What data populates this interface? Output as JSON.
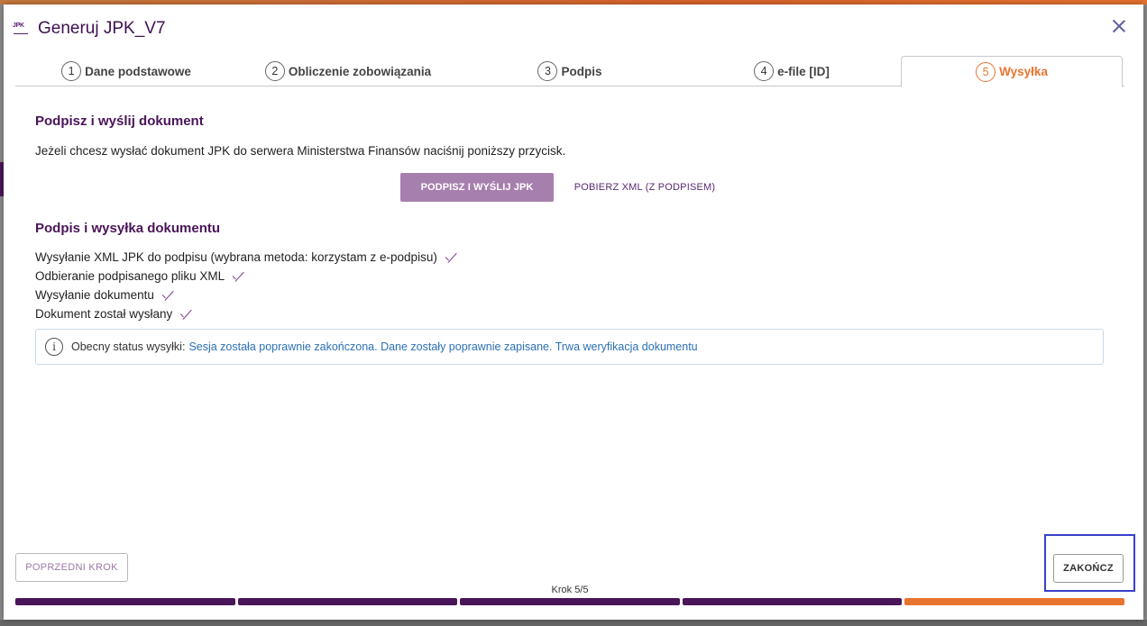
{
  "dialog": {
    "icon_label": "JPK",
    "title": "Generuj JPK_V7"
  },
  "tabs": [
    {
      "num": "1",
      "label": "Dane podstawowe",
      "active": false
    },
    {
      "num": "2",
      "label": "Obliczenie zobowiązania",
      "active": false
    },
    {
      "num": "3",
      "label": "Podpis",
      "active": false
    },
    {
      "num": "4",
      "label": "e-file [ID]",
      "active": false
    },
    {
      "num": "5",
      "label": "Wysyłka",
      "active": true
    }
  ],
  "sign_section": {
    "title": "Podpisz i wyślij dokument",
    "description": "Jeżeli chcesz wysłać dokument JPK do serwera Ministerstwa Finansów naciśnij poniższy przycisk.",
    "sign_send_button": "PODPISZ I WYŚLIJ JPK",
    "download_xml_button": "POBIERZ XML (Z PODPISEM)"
  },
  "progress_section": {
    "title": "Podpis i wysyłka dokumentu",
    "steps": [
      "Wysyłanie XML JPK do podpisu (wybrana metoda: korzystam z e-podpisu)",
      "Odbieranie podpisanego pliku XML",
      "Wysyłanie dokumentu",
      "Dokument został wysłany"
    ]
  },
  "status": {
    "icon": "info-icon",
    "label": "Obecny status wysyłki:",
    "value": "Sesja została poprawnie zakończona. Dane zostały poprawnie zapisane. Trwa weryfikacja dokumentu"
  },
  "footer": {
    "prev_button": "POPRZEDNI KROK",
    "finish_button": "ZAKOŃCZ",
    "step_text": "Krok 5/5",
    "current_step": 5,
    "total_steps": 5
  },
  "colors": {
    "brand_purple": "#4a1559",
    "accent_orange": "#e8742f",
    "status_blue": "#2b70b6"
  }
}
